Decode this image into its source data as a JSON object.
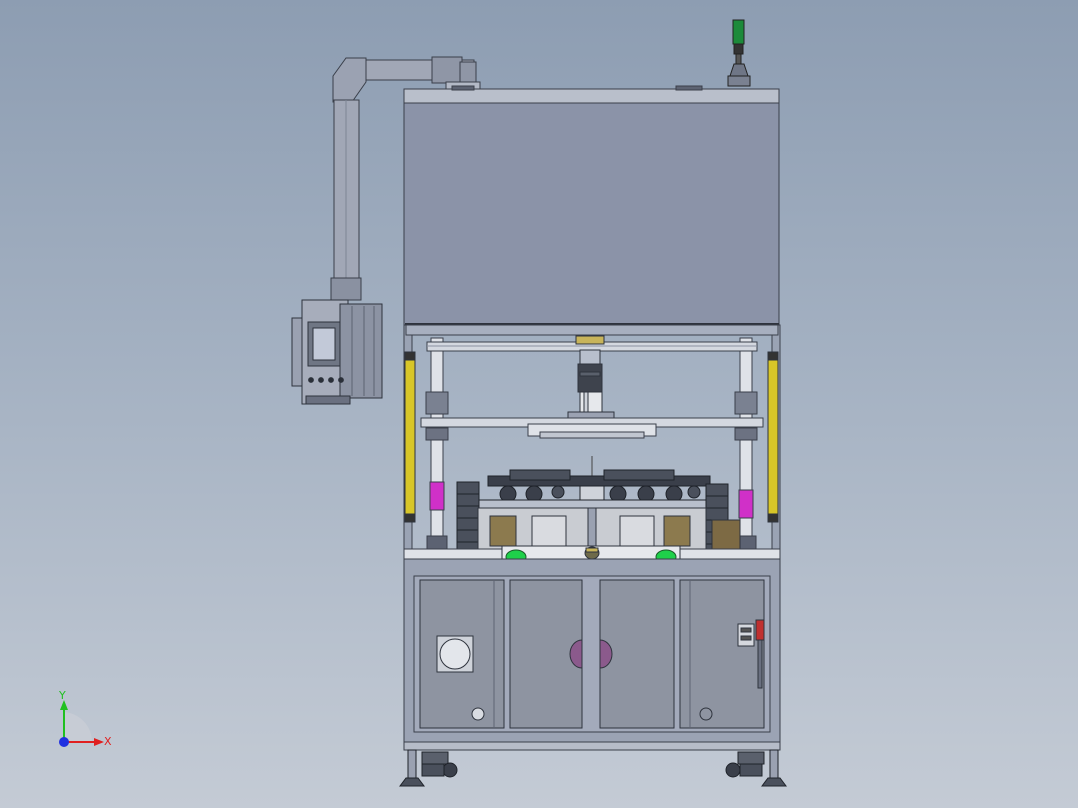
{
  "viewport": {
    "model": "machine-front-view",
    "background_top": "#8d9db2",
    "background_bottom": "#c4cbd5"
  },
  "triad": {
    "x_label": "X",
    "y_label": "Y",
    "x_color": "#e02020",
    "y_color": "#20c020",
    "z_color": "#2030e0"
  },
  "colors": {
    "upper_cover": "#8b93a8",
    "frame": "#9aa3b4",
    "light_curtain": "#d8c628",
    "magenta_band": "#d030c8",
    "start_button": "#1fd04a",
    "signal_tower_green": "#1c8a3a",
    "hmi_screen": "#bfc6d6"
  },
  "icons": {
    "signal_tower": "signal-tower-icon",
    "hmi_panel": "hmi-panel-icon",
    "fan": "fan-grille-icon"
  }
}
